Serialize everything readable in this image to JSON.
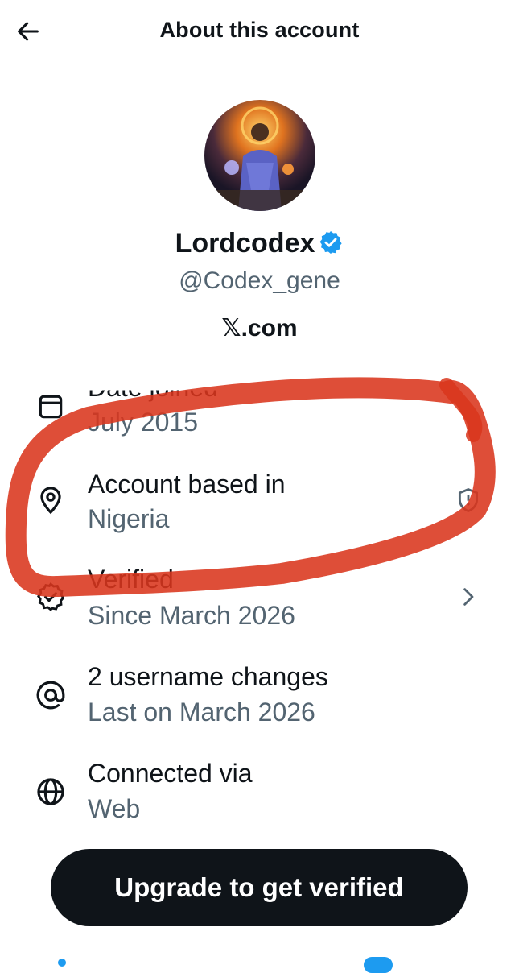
{
  "header": {
    "title": "About this account",
    "back_icon": "arrow-left-icon"
  },
  "profile": {
    "display_name": "Lordcodex",
    "verified_badge": "verified-badge-icon",
    "handle": "@Codex_gene",
    "site_prefix": "𝕏",
    "site_suffix": ".com"
  },
  "rows": [
    {
      "icon": "calendar-icon",
      "label": "Date joined",
      "value": "July 2015"
    },
    {
      "icon": "location-pin-icon",
      "label": "Account based in",
      "value": "Nigeria",
      "trailing_icon": "shield-icon"
    },
    {
      "icon": "verified-icon",
      "label": "Verified",
      "value": "Since March 2026",
      "trailing_icon": "chevron-right-icon"
    },
    {
      "icon": "at-sign-icon",
      "label": "2 username changes",
      "value": "Last on March 2026"
    },
    {
      "icon": "globe-icon",
      "label": "Connected via",
      "value": "Web"
    }
  ],
  "cta": {
    "label": "Upgrade to get verified"
  },
  "colors": {
    "accent": "#1d9bf0",
    "text": "#0f1419",
    "secondary": "#536471",
    "highlight": "#d9361c"
  }
}
